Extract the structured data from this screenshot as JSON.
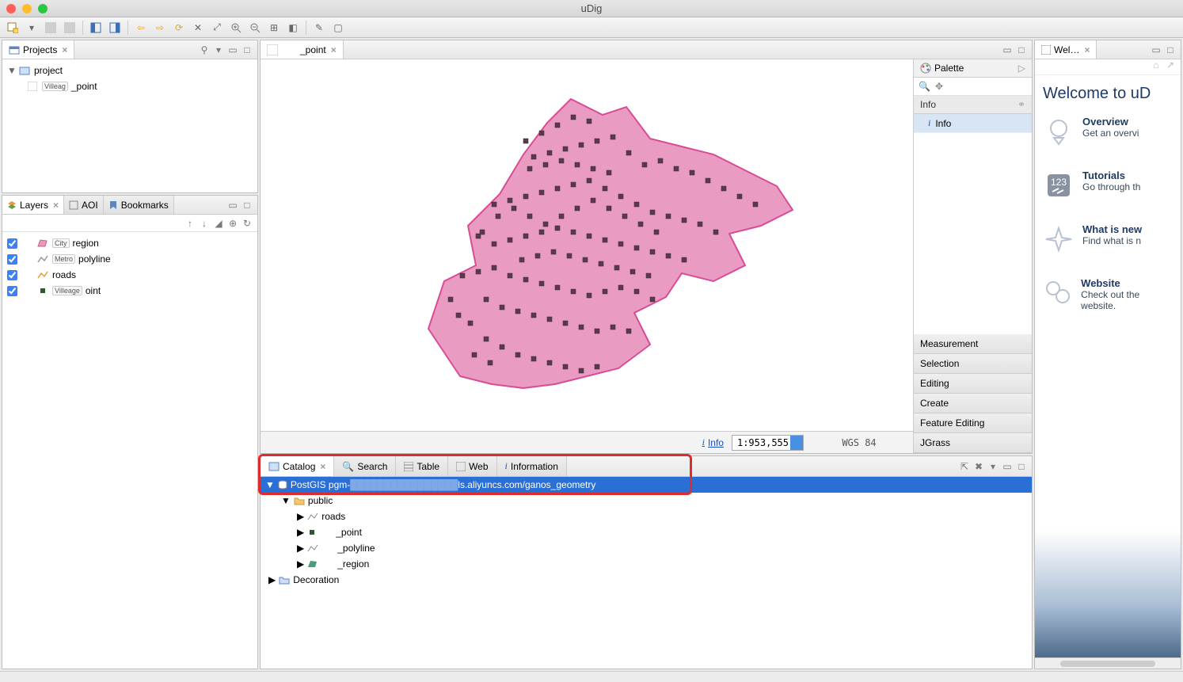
{
  "app": {
    "title": "uDig"
  },
  "projects": {
    "tab": "Projects",
    "root": "project",
    "child_tag": "Villeag",
    "child": "_point"
  },
  "layers": {
    "tabs": [
      "Layers",
      "AOI",
      "Bookmarks"
    ],
    "items": [
      {
        "tag": "City",
        "label": "region"
      },
      {
        "tag": "Metro",
        "label": "polyline"
      },
      {
        "tag": "",
        "label": "roads"
      },
      {
        "tag": "Villeage",
        "label": "oint"
      }
    ]
  },
  "map": {
    "tab": "_point",
    "info_link": "Info",
    "scale": "1:953,555",
    "crs": "WGS 84"
  },
  "palette": {
    "title": "Palette",
    "info_section": "Info",
    "info_item": "Info",
    "categories": [
      "Measurement",
      "Selection",
      "Editing",
      "Create",
      "Feature Editing",
      "JGrass"
    ]
  },
  "catalog": {
    "tabs": [
      "Catalog",
      "Search",
      "Table",
      "Web",
      "Information"
    ],
    "postgis_prefix": "PostGIS pgm-",
    "postgis_suffix": "ls.aliyuncs.com/ganos_geometry",
    "schema": "public",
    "tables": [
      "roads",
      "_point",
      "_polyline",
      "_region"
    ],
    "decoration": "Decoration"
  },
  "welcome": {
    "tab": "Wel…",
    "heading": "Welcome to uD",
    "items": [
      {
        "title": "Overview",
        "desc": "Get an overvi"
      },
      {
        "title": "Tutorials",
        "desc": "Go through th"
      },
      {
        "title": "What is new",
        "desc": "Find what is n"
      },
      {
        "title": "Website",
        "desc": "Check out the website."
      }
    ]
  }
}
